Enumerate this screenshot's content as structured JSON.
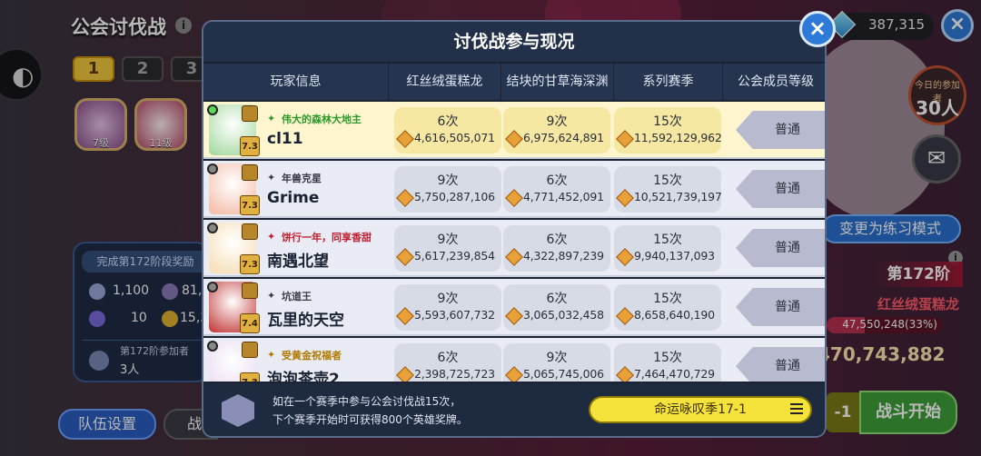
{
  "screen": {
    "title": "公会讨伐战",
    "stage_tabs": [
      "1",
      "2",
      "3"
    ],
    "boss_levels": [
      "7级",
      "11级"
    ],
    "reward_box": {
      "title": "完成第172阶段奖励",
      "items": [
        "1,100",
        "81,5",
        "10",
        "15,3"
      ],
      "participants_label": "第172阶参加者",
      "participants_value": "3人"
    },
    "team_button": "队伍设置",
    "battle_left_button": "战",
    "currency": "387,315",
    "today_label": "今日的参加者",
    "today_value": "30人",
    "practice_button": "变更为练习模式",
    "stage": "第172阶",
    "boss_name": "红丝绒蛋糕龙",
    "hp_text": "47,550,248(33%)",
    "hp_fraction": 0.33,
    "score": "470,743,882",
    "minus_label": "-1",
    "start_button": "战斗开始"
  },
  "modal": {
    "title": "讨伐战参与现况",
    "columns": [
      "玩家信息",
      "红丝绒蛋糕龙",
      "结块的甘草海深渊",
      "系列赛季",
      "公会成员等级"
    ],
    "rows": [
      {
        "online": true,
        "tier_badge": "7.3",
        "title": "伟大的森林大地主",
        "title_color": "#2a9a2a",
        "name": "cl11",
        "c1": {
          "times": "6次",
          "dmg": "4,616,505,071"
        },
        "c2": {
          "times": "9次",
          "dmg": "6,975,624,891"
        },
        "c3": {
          "times": "15次",
          "dmg": "11,592,129,962"
        },
        "rank": "普通",
        "avatar_color": "#9fd69a"
      },
      {
        "online": false,
        "tier_badge": "7.3",
        "title": "年兽克星",
        "title_color": "#3a3a4a",
        "name": "Grime",
        "c1": {
          "times": "9次",
          "dmg": "5,750,287,106"
        },
        "c2": {
          "times": "6次",
          "dmg": "4,771,452,091"
        },
        "c3": {
          "times": "15次",
          "dmg": "10,521,739,197"
        },
        "rank": "普通",
        "avatar_color": "#f3b8a0"
      },
      {
        "online": false,
        "tier_badge": "7.3",
        "title": "饼行一年，同享香甜",
        "title_color": "#c02030",
        "name": "南遇北望",
        "c1": {
          "times": "9次",
          "dmg": "5,617,239,854"
        },
        "c2": {
          "times": "6次",
          "dmg": "4,322,897,239"
        },
        "c3": {
          "times": "15次",
          "dmg": "9,940,137,093"
        },
        "rank": "普通",
        "avatar_color": "#f6dcb0"
      },
      {
        "online": false,
        "tier_badge": "7.4",
        "title": "坑道王",
        "title_color": "#3a3a4a",
        "name": "瓦里的天空",
        "c1": {
          "times": "9次",
          "dmg": "5,593,607,732"
        },
        "c2": {
          "times": "6次",
          "dmg": "3,065,032,458"
        },
        "c3": {
          "times": "15次",
          "dmg": "8,658,640,190"
        },
        "rank": "普通",
        "avatar_color": "#c03030"
      },
      {
        "online": false,
        "tier_badge": "7.3",
        "title": "受黄金祝福者",
        "title_color": "#b07a00",
        "name": "泡泡茶壶2",
        "c1": {
          "times": "6次",
          "dmg": "2,398,725,723"
        },
        "c2": {
          "times": "9次",
          "dmg": "5,065,745,006"
        },
        "c3": {
          "times": "15次",
          "dmg": "7,464,470,729"
        },
        "rank": "普通",
        "avatar_color": "#e8d8f0"
      }
    ],
    "footer_text_1": "如在一个赛季中参与公会讨伐战15次，",
    "footer_text_2": "下个赛季开始时可获得800个英雄奖牌。",
    "season_button": "命运咏叹季17-1"
  },
  "icons": {
    "back": "back-icon",
    "info": "info-icon",
    "close": "close-icon",
    "diamond": "diamond-icon",
    "chat": "chat-icon",
    "damage": "damage-icon",
    "menu": "menu-icon",
    "season_emblem": "season-emblem-icon"
  }
}
